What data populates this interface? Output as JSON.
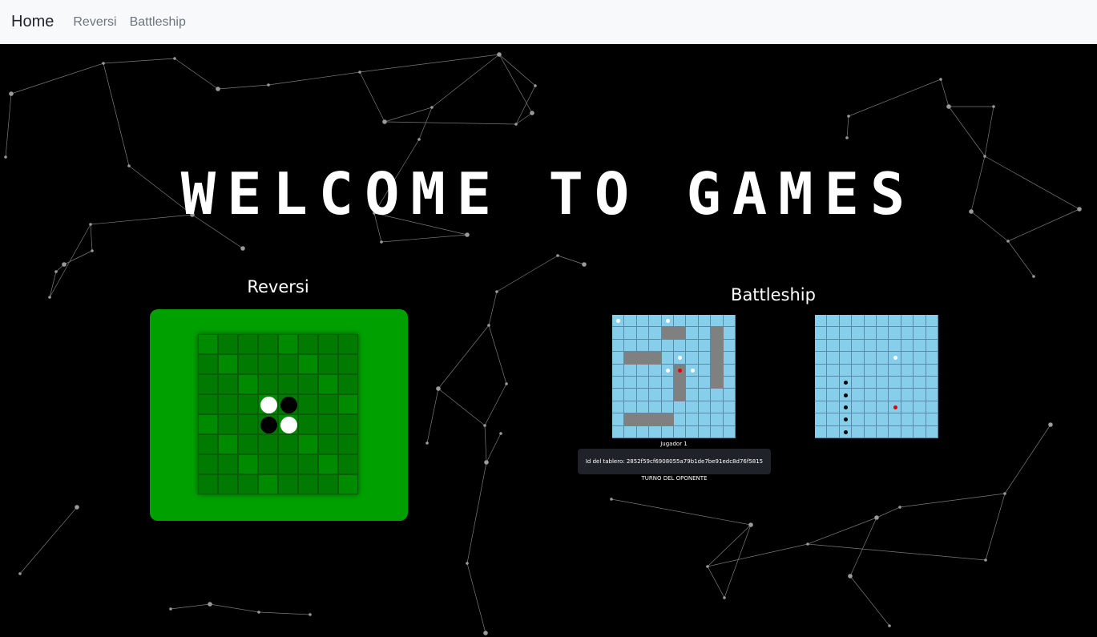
{
  "nav": {
    "brand": "Home",
    "links": [
      "Reversi",
      "Battleship"
    ]
  },
  "hero": {
    "title": "WELCOME TO GAMES"
  },
  "reversi": {
    "title": "Reversi",
    "discs": [
      {
        "row": 3,
        "col": 3,
        "color": "white"
      },
      {
        "row": 3,
        "col": 4,
        "color": "black"
      },
      {
        "row": 4,
        "col": 3,
        "color": "black"
      },
      {
        "row": 4,
        "col": 4,
        "color": "white"
      }
    ]
  },
  "battleship": {
    "title": "Battleship",
    "player_label": "Jugador 1",
    "id_label": "Id del tablero:",
    "board_id": "2852f59cf6908055a79b1de7be91edc8d76f5815",
    "turn_status": "TURNO DEL OPONENTE",
    "own_board": {
      "ships": [
        {
          "row": 1,
          "col": 4,
          "length": 2,
          "orientation": "h"
        },
        {
          "row": 1,
          "col": 8,
          "length": 5,
          "orientation": "v"
        },
        {
          "row": 3,
          "col": 1,
          "length": 3,
          "orientation": "h"
        },
        {
          "row": 4,
          "col": 5,
          "length": 3,
          "orientation": "v"
        },
        {
          "row": 8,
          "col": 1,
          "length": 4,
          "orientation": "h"
        }
      ],
      "misses": [
        [
          0,
          0
        ],
        [
          0,
          4
        ],
        [
          3,
          5
        ],
        [
          4,
          4
        ],
        [
          4,
          6
        ]
      ],
      "hits": [
        [
          4,
          5
        ]
      ]
    },
    "opponent_board": {
      "misses": [
        [
          3,
          6
        ]
      ],
      "hits": [
        [
          7,
          6
        ]
      ],
      "sunk": [
        [
          5,
          2
        ],
        [
          6,
          2
        ],
        [
          7,
          2
        ],
        [
          8,
          2
        ],
        [
          9,
          2
        ]
      ]
    }
  },
  "colors": {
    "reversi_frame": "#00a000",
    "cell_dark": "#007a00",
    "cell_light": "#008a00",
    "water": "#87ceeb",
    "ship": "#808080",
    "hit": "#e00000"
  }
}
